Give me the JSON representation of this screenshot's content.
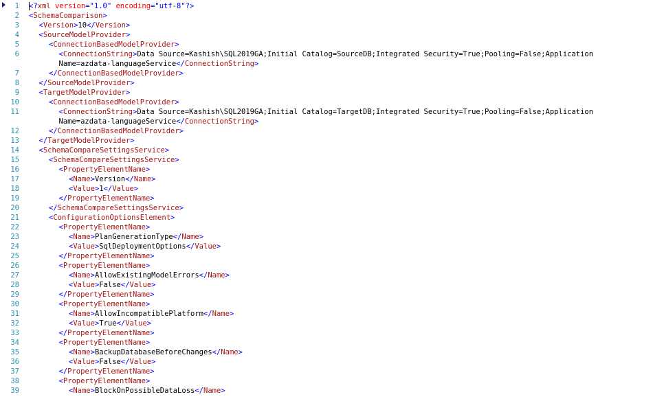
{
  "editor": {
    "lines": [
      {
        "n": "1",
        "indent": 0,
        "kind": "decl"
      },
      {
        "n": "2",
        "indent": 0,
        "open": "SchemaComparison"
      },
      {
        "n": "3",
        "indent": 1,
        "open": "Version",
        "text": "10",
        "close": "Version"
      },
      {
        "n": "4",
        "indent": 1,
        "open": "SourceModelProvider"
      },
      {
        "n": "5",
        "indent": 2,
        "open": "ConnectionBasedModelProvider"
      },
      {
        "n": "6",
        "indent": 3,
        "open": "ConnectionString",
        "text": "Data Source=Kashish\\SQL2019GA;Initial Catalog=SourceDB;Integrated Security=True;Pooling=False;Application"
      },
      {
        "n": "",
        "indent": 3,
        "text": "Name=azdata-languageService",
        "close": "ConnectionString"
      },
      {
        "n": "7",
        "indent": 2,
        "close": "ConnectionBasedModelProvider"
      },
      {
        "n": "8",
        "indent": 1,
        "close": "SourceModelProvider"
      },
      {
        "n": "9",
        "indent": 1,
        "open": "TargetModelProvider"
      },
      {
        "n": "10",
        "indent": 2,
        "open": "ConnectionBasedModelProvider"
      },
      {
        "n": "11",
        "indent": 3,
        "open": "ConnectionString",
        "text": "Data Source=Kashish\\SQL2019GA;Initial Catalog=TargetDB;Integrated Security=True;Pooling=False;Application"
      },
      {
        "n": "",
        "indent": 3,
        "text": "Name=azdata-languageService",
        "close": "ConnectionString"
      },
      {
        "n": "12",
        "indent": 2,
        "close": "ConnectionBasedModelProvider"
      },
      {
        "n": "13",
        "indent": 1,
        "close": "TargetModelProvider"
      },
      {
        "n": "14",
        "indent": 1,
        "open": "SchemaCompareSettingsService"
      },
      {
        "n": "15",
        "indent": 2,
        "open": "SchemaCompareSettingsService"
      },
      {
        "n": "16",
        "indent": 3,
        "open": "PropertyElementName"
      },
      {
        "n": "17",
        "indent": 4,
        "open": "Name",
        "text": "Version",
        "close": "Name"
      },
      {
        "n": "18",
        "indent": 4,
        "open": "Value",
        "text": "1",
        "close": "Value"
      },
      {
        "n": "19",
        "indent": 3,
        "close": "PropertyElementName"
      },
      {
        "n": "20",
        "indent": 2,
        "close": "SchemaCompareSettingsService"
      },
      {
        "n": "21",
        "indent": 2,
        "open": "ConfigurationOptionsElement"
      },
      {
        "n": "22",
        "indent": 3,
        "open": "PropertyElementName"
      },
      {
        "n": "23",
        "indent": 4,
        "open": "Name",
        "text": "PlanGenerationType",
        "close": "Name"
      },
      {
        "n": "24",
        "indent": 4,
        "open": "Value",
        "text": "SqlDeploymentOptions",
        "close": "Value"
      },
      {
        "n": "25",
        "indent": 3,
        "close": "PropertyElementName"
      },
      {
        "n": "26",
        "indent": 3,
        "open": "PropertyElementName"
      },
      {
        "n": "27",
        "indent": 4,
        "open": "Name",
        "text": "AllowExistingModelErrors",
        "close": "Name"
      },
      {
        "n": "28",
        "indent": 4,
        "open": "Value",
        "text": "False",
        "close": "Value"
      },
      {
        "n": "29",
        "indent": 3,
        "close": "PropertyElementName"
      },
      {
        "n": "30",
        "indent": 3,
        "open": "PropertyElementName"
      },
      {
        "n": "31",
        "indent": 4,
        "open": "Name",
        "text": "AllowIncompatiblePlatform",
        "close": "Name"
      },
      {
        "n": "32",
        "indent": 4,
        "open": "Value",
        "text": "True",
        "close": "Value"
      },
      {
        "n": "33",
        "indent": 3,
        "close": "PropertyElementName"
      },
      {
        "n": "34",
        "indent": 3,
        "open": "PropertyElementName"
      },
      {
        "n": "35",
        "indent": 4,
        "open": "Name",
        "text": "BackupDatabaseBeforeChanges",
        "close": "Name"
      },
      {
        "n": "36",
        "indent": 4,
        "open": "Value",
        "text": "False",
        "close": "Value"
      },
      {
        "n": "37",
        "indent": 3,
        "close": "PropertyElementName"
      },
      {
        "n": "38",
        "indent": 3,
        "open": "PropertyElementName"
      },
      {
        "n": "39",
        "indent": 4,
        "open": "Name",
        "text": "BlockOnPossibleDataLoss",
        "close": "Name"
      }
    ],
    "declaration": {
      "name": "xml",
      "attrs": [
        {
          "name": "version",
          "value": "\"1.0\""
        },
        {
          "name": "encoding",
          "value": "\"utf-8\""
        }
      ]
    }
  },
  "colors": {
    "line_number": "#2b91af",
    "tag": "#a31515",
    "punctuation": "#0000ff",
    "attribute": "#ff0000",
    "attribute_value": "#0000ff",
    "marker": "#1e1e7e"
  },
  "icons": {
    "current_line_marker": "triangle-right-icon"
  }
}
